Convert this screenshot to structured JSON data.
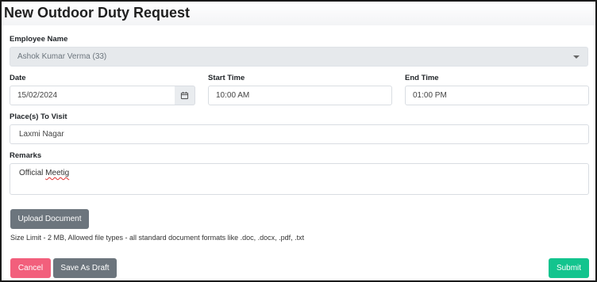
{
  "page": {
    "title": "New Outdoor Duty Request"
  },
  "form": {
    "employee": {
      "label": "Employee Name",
      "value": "Ashok Kumar Verma (33)"
    },
    "date": {
      "label": "Date",
      "value": "15/02/2024"
    },
    "start_time": {
      "label": "Start Time",
      "value": "10:00 AM"
    },
    "end_time": {
      "label": "End Time",
      "value": "01:00 PM"
    },
    "places": {
      "label": "Place(s) To Visit",
      "value": "Laxmi Nagar"
    },
    "remarks": {
      "label": "Remarks",
      "value_prefix": "Official ",
      "value_typo": "Meetig"
    },
    "upload": {
      "button_label": "Upload Document",
      "hint": "Size Limit - 2 MB, Allowed file types - all standard document formats like .doc, .docx, .pdf, .txt"
    }
  },
  "actions": {
    "cancel_label": "Cancel",
    "draft_label": "Save As Draft",
    "submit_label": "Submit"
  },
  "colors": {
    "cancel": "#f25f7c",
    "secondary": "#6c757d",
    "submit": "#13c48e"
  }
}
